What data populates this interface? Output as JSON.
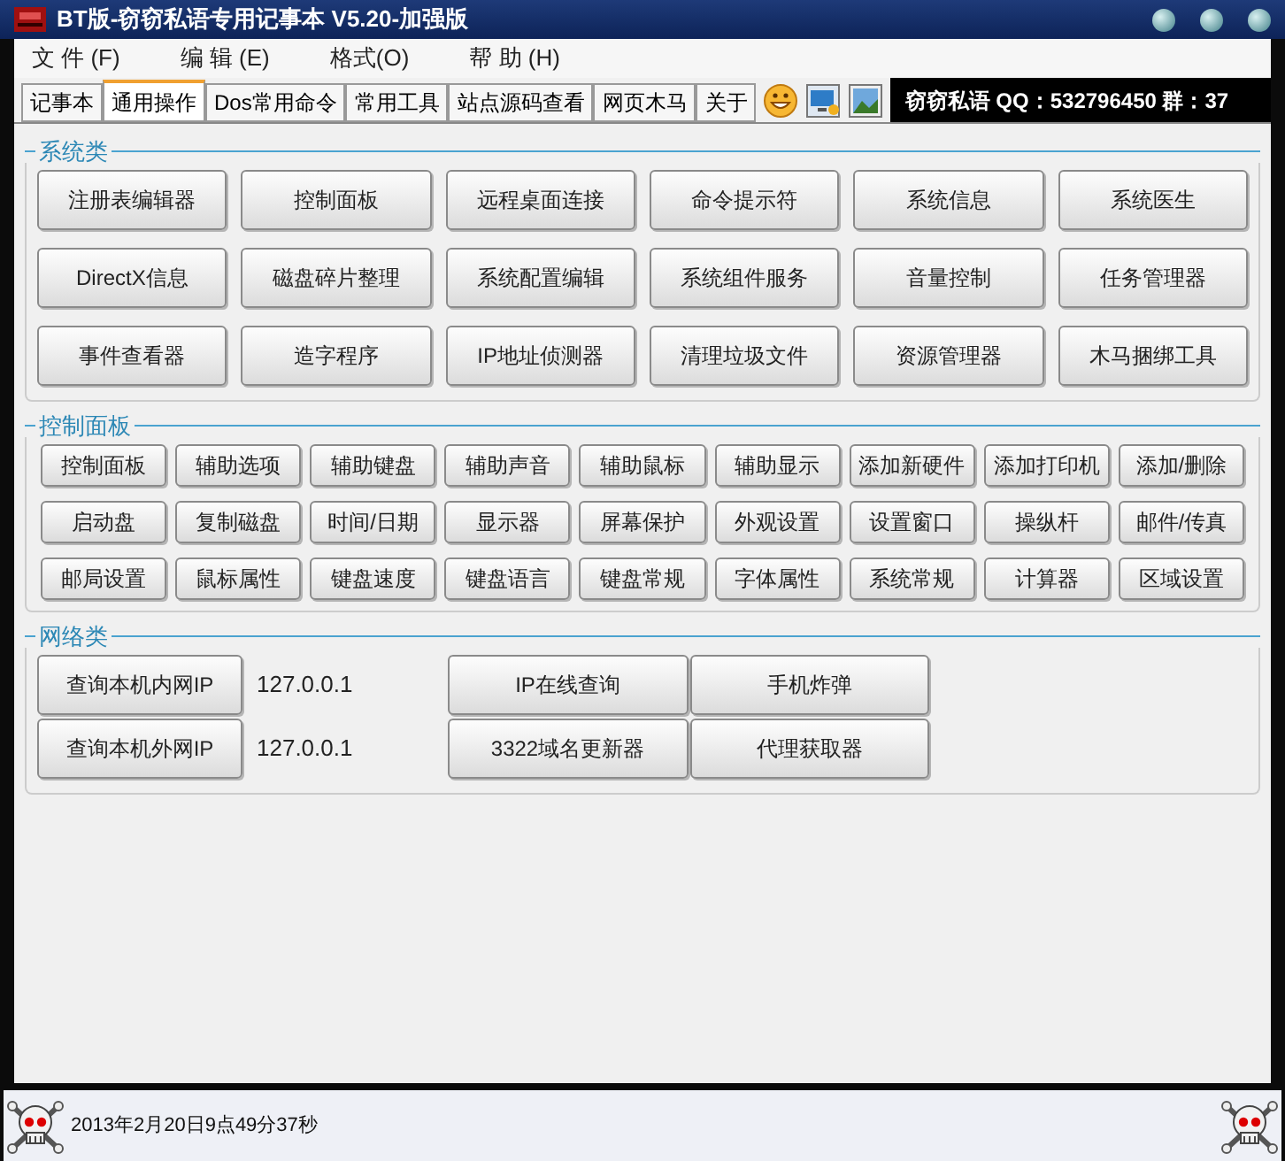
{
  "window": {
    "title": "BT版-窃窃私语专用记事本 V5.20-加强版"
  },
  "menu": [
    "文 件 (F)",
    "编 辑 (E)",
    "格式(O)",
    "帮 助 (H)"
  ],
  "tabs": [
    {
      "label": "记事本",
      "selected": false
    },
    {
      "label": "通用操作",
      "selected": true
    },
    {
      "label": "Dos常用命令",
      "selected": false
    },
    {
      "label": "常用工具",
      "selected": false
    },
    {
      "label": "站点源码查看",
      "selected": false
    },
    {
      "label": "网页木马",
      "selected": false
    },
    {
      "label": "关于",
      "selected": false
    }
  ],
  "banner": "窃窃私语 QQ：532796450 群：37",
  "system_group": {
    "title": "系统类",
    "buttons": [
      "注册表编辑器",
      "控制面板",
      "远程桌面连接",
      "命令提示符",
      "系统信息",
      "系统医生",
      "DirectX信息",
      "磁盘碎片整理",
      "系统配置编辑",
      "系统组件服务",
      "音量控制",
      "任务管理器",
      "事件查看器",
      "造字程序",
      "IP地址侦测器",
      "清理垃圾文件",
      "资源管理器",
      "木马捆绑工具"
    ]
  },
  "control_group": {
    "title": "控制面板",
    "buttons": [
      "控制面板",
      "辅助选项",
      "辅助键盘",
      "辅助声音",
      "辅助鼠标",
      "辅助显示",
      "添加新硬件",
      "添加打印机",
      "添加/删除",
      "启动盘",
      "复制磁盘",
      "时间/日期",
      "显示器",
      "屏幕保护",
      "外观设置",
      "设置窗口",
      "操纵杆",
      "邮件/传真",
      "邮局设置",
      "鼠标属性",
      "键盘速度",
      "键盘语言",
      "键盘常规",
      "字体属性",
      "系统常规",
      "计算器",
      "区域设置"
    ]
  },
  "network_group": {
    "title": "网络类",
    "rows": [
      {
        "button": "查询本机内网IP",
        "ip": "127.0.0.1"
      },
      {
        "button": "查询本机外网IP",
        "ip": "127.0.0.1"
      }
    ],
    "buttons": [
      "IP在线查询",
      "手机炸弹",
      "3322域名更新器",
      "代理获取器"
    ]
  },
  "status_bar": {
    "datetime": "2013年2月20日9点49分37秒"
  }
}
